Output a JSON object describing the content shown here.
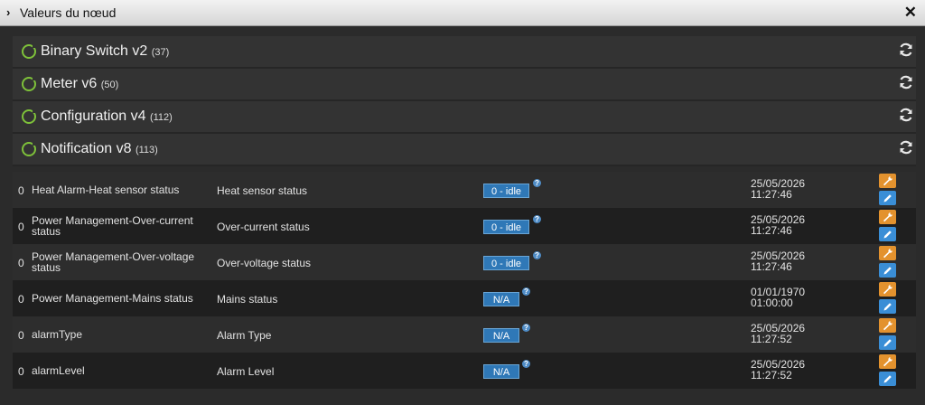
{
  "window": {
    "title": "Valeurs du nœud"
  },
  "panels": [
    {
      "name": "Binary Switch v2",
      "id": "(37)"
    },
    {
      "name": "Meter v6",
      "id": "(50)"
    },
    {
      "name": "Configuration v4",
      "id": "(112)"
    },
    {
      "name": "Notification v8",
      "id": "(113)"
    }
  ],
  "rows": [
    {
      "index": "0",
      "name": "Heat Alarm-Heat sensor status",
      "label": "Heat sensor status",
      "value": "0 - idle",
      "help": "?",
      "date": "25/05/2026",
      "time": "11:27:46"
    },
    {
      "index": "0",
      "name": "Power Management-Over-current status",
      "label": "Over-current status",
      "value": "0 - idle",
      "help": "?",
      "date": "25/05/2026",
      "time": "11:27:46"
    },
    {
      "index": "0",
      "name": "Power Management-Over-voltage status",
      "label": "Over-voltage status",
      "value": "0 - idle",
      "help": "?",
      "date": "25/05/2026",
      "time": "11:27:46"
    },
    {
      "index": "0",
      "name": "Power Management-Mains status",
      "label": "Mains status",
      "value": "N/A",
      "help": "?",
      "date": "01/01/1970",
      "time": "01:00:00"
    },
    {
      "index": "0",
      "name": "alarmType",
      "label": "Alarm Type",
      "value": "N/A",
      "help": "?",
      "date": "25/05/2026",
      "time": "11:27:52"
    },
    {
      "index": "0",
      "name": "alarmLevel",
      "label": "Alarm Level",
      "value": "N/A",
      "help": "?",
      "date": "25/05/2026",
      "time": "11:27:52"
    }
  ],
  "icons": {
    "collapse": "chevron-right-icon",
    "close": "close-icon",
    "panel_status": "status-ring-icon",
    "refresh": "refresh-icon",
    "help": "help-icon",
    "configure": "wrench-icon",
    "edit": "pencil-icon"
  },
  "colors": {
    "status_green": "#7ec13a",
    "value_blue": "#2f78b7",
    "wrench_orange": "#e3922e",
    "pencil_blue": "#3a8ed6"
  }
}
